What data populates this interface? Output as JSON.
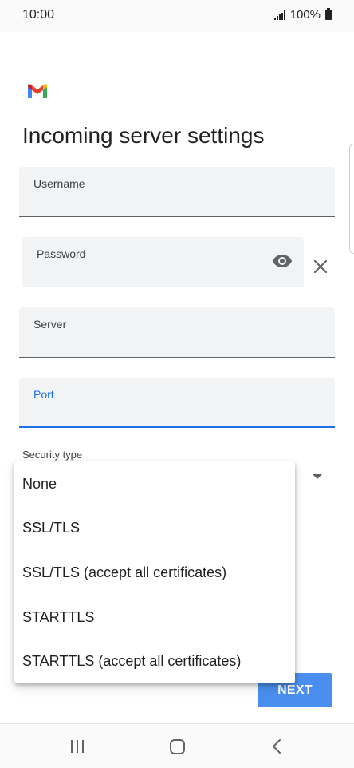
{
  "status_bar": {
    "time": "10:00",
    "battery_text": "100%"
  },
  "header": {
    "logo_icon": "gmail-logo",
    "title": "Incoming server settings"
  },
  "form": {
    "username_label": "Username",
    "password_label": "Password",
    "password_toggle_icon": "eye-icon",
    "password_clear_icon": "close-icon",
    "server_label": "Server",
    "port_label": "Port",
    "security_type_label": "Security type"
  },
  "security_options": [
    "None",
    "SSL/TLS",
    "SSL/TLS (accept all certificates)",
    "STARTTLS",
    "STARTTLS (accept all certificates)"
  ],
  "actions": {
    "next_label": "NEXT"
  },
  "nav": {
    "recents_icon": "recents-icon",
    "home_icon": "home-icon",
    "back_icon": "back-icon"
  },
  "colors": {
    "accent": "#1a73e8",
    "next_button": "#4a8ff0",
    "field_background": "#f1f3f4"
  }
}
